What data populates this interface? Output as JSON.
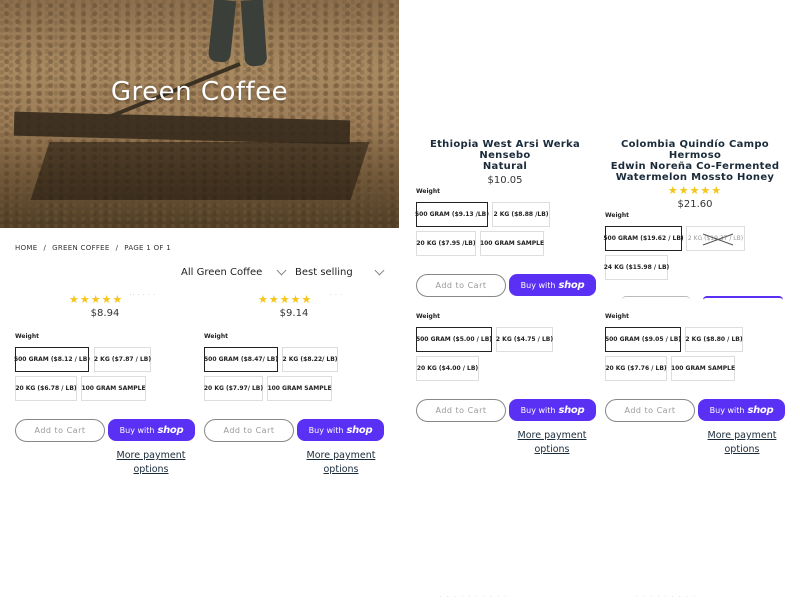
{
  "hero": {
    "title": "Green Coffee"
  },
  "breadcrumb": {
    "home": "HOME",
    "sep": "/",
    "collection": "GREEN COFFEE",
    "page": "PAGE 1 OF 1"
  },
  "filters": {
    "collection": "All Green Coffee",
    "sort": "Best selling"
  },
  "common": {
    "weight_label": "Weight",
    "add_to_cart": "Add to Cart",
    "buy_with": "Buy with",
    "shop": "shop",
    "more_payment_line1": "More payment",
    "more_payment_line2": "options"
  },
  "products": [
    {
      "title_line1": "",
      "title_line2": "",
      "stars": "★★★★★",
      "rating": 4.5,
      "price": "$8.94",
      "variants": [
        "500 GRAM ($8.12 / LB)",
        "2 KG ($7.87 / LB)",
        "20 KG ($6.78 / LB)",
        "100 GRAM SAMPLE"
      ]
    },
    {
      "title_line1": "",
      "title_line2": "",
      "stars": "★★★★★",
      "rating": 4.5,
      "price": "$9.14",
      "variants": [
        "500 GRAM ($8.47/ LB)",
        "2 KG ($8.22/ LB)",
        "20 KG ($7.97/ LB)",
        "100 GRAM SAMPLE"
      ]
    },
    {
      "title_line1": "Ethiopia West Arsi Werka Nensebo",
      "title_line2": "Natural",
      "price": "$10.05",
      "variants": [
        "500 GRAM ($9.13 /LB)",
        "2 KG ($8.88 /LB)",
        "20 KG ($7.95 /LB)",
        "100 GRAM SAMPLE"
      ]
    },
    {
      "title_line1": "Colombia Quindío Campo Hermoso",
      "title_line2": "Edwin Noreña Co-Fermented",
      "title_line3": "Watermelon Mossto Honey",
      "stars": "★★★★★",
      "rating": 4.5,
      "price": "$21.60",
      "variants": [
        "500 GRAM ($19.62 / LB)",
        "2 KG ($19.37 / LB)",
        "24 KG ($15.98 / LB)"
      ]
    },
    {
      "variants": [
        "500 GRAM ($5.00 / LB)",
        "2 KG ($4.75 / LB)",
        "20 KG ($4.00 / LB)"
      ]
    },
    {
      "variants": [
        "500 GRAM ($9.05 / LB)",
        "2 KG ($8.80 / LB)",
        "20 KG ($7.76 / LB)",
        "100 GRAM SAMPLE"
      ]
    }
  ]
}
